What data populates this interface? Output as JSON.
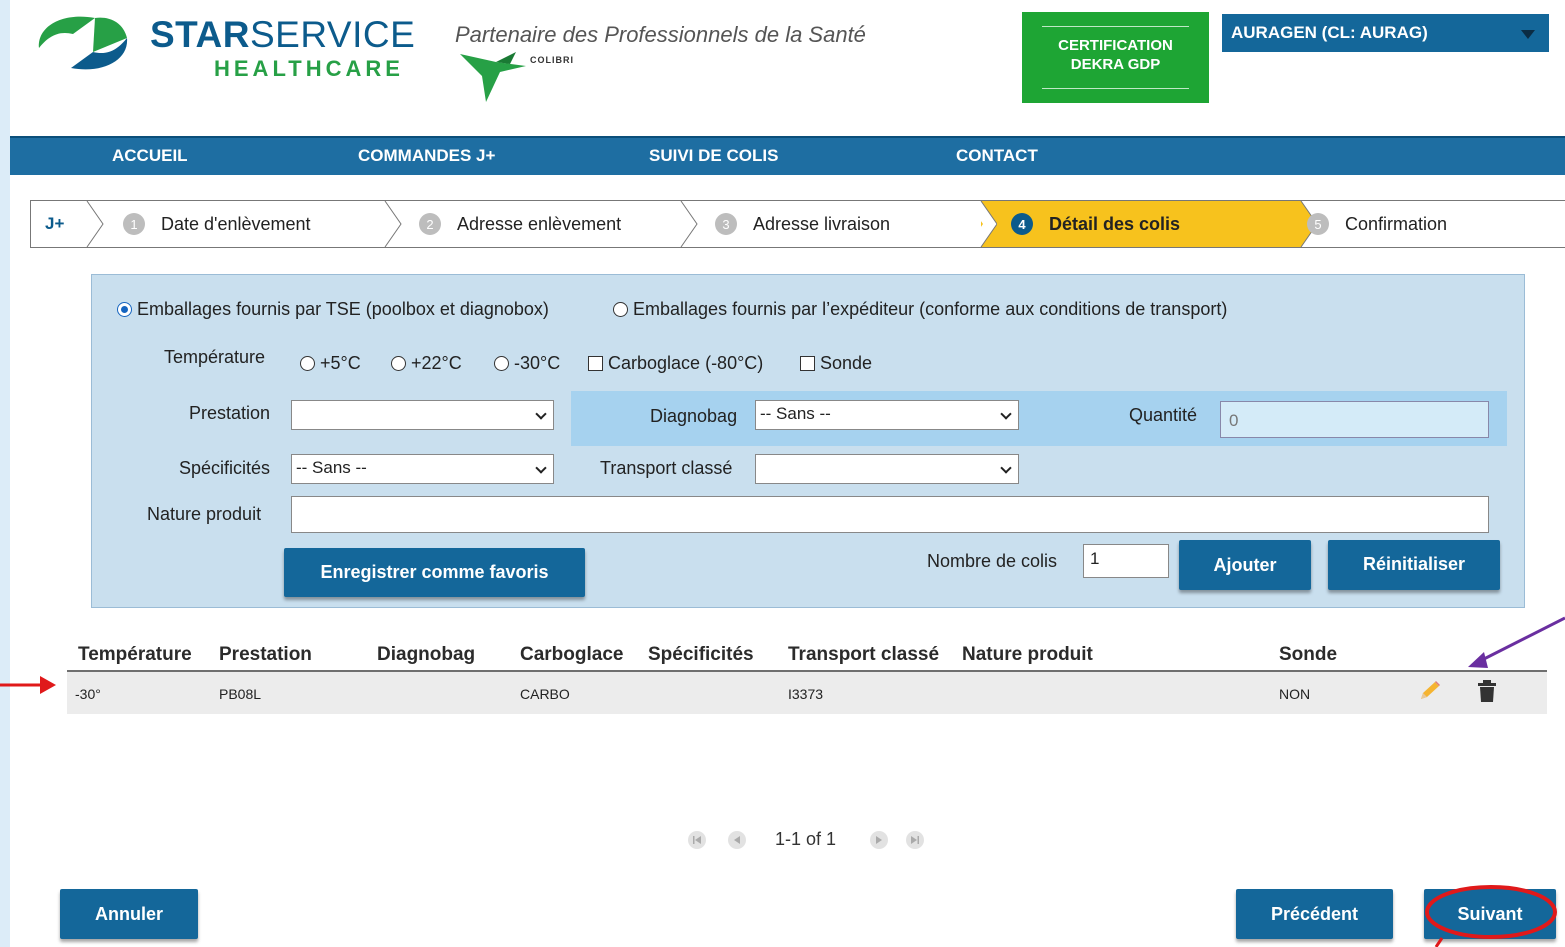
{
  "header": {
    "brand_bold": "STAR",
    "brand_light": "SERVICE",
    "brand_sub": "HEALTHCARE",
    "tagline": "Partenaire des Professionnels de la Santé",
    "colibri": "COLIBRI",
    "cert_line1": "CERTIFICATION",
    "cert_line2": "DEKRA GDP",
    "account": "AURAGEN (CL: AURAG)"
  },
  "nav": [
    "ACCUEIL",
    "COMMANDES J+",
    "SUIVI DE COLIS",
    "CONTACT"
  ],
  "stepper": {
    "prefix": "J+",
    "steps": [
      {
        "num": "1",
        "label": "Date d'enlèvement"
      },
      {
        "num": "2",
        "label": "Adresse enlèvement"
      },
      {
        "num": "3",
        "label": "Adresse livraison"
      },
      {
        "num": "4",
        "label": "Détail des colis"
      },
      {
        "num": "5",
        "label": "Confirmation"
      }
    ]
  },
  "form": {
    "packaging_tse": "Emballages fournis par TSE (poolbox et diagnobox)",
    "packaging_sender": "Emballages fournis par l’expéditeur (conforme aux conditions de transport)",
    "temp_label": "Température",
    "temp_options": [
      "+5°C",
      "+22°C",
      "-30°C"
    ],
    "carboglace": "Carboglace (-80°C)",
    "sonde": "Sonde",
    "prestation_label": "Prestation",
    "prestation_value": "",
    "diagnobag_label": "Diagnobag",
    "diagnobag_value": "-- Sans --",
    "quantite_label": "Quantité",
    "quantite_value": "0",
    "specificites_label": "Spécificités",
    "specificites_value": "-- Sans --",
    "transport_label": "Transport classé",
    "transport_value": "",
    "nature_label": "Nature produit",
    "nature_value": "",
    "favoris_button": "Enregistrer comme favoris",
    "nb_colis_label": "Nombre de colis",
    "nb_colis_value": "1",
    "ajouter_button": "Ajouter",
    "reinit_button": "Réinitialiser"
  },
  "table": {
    "headers": [
      "Température",
      "Prestation",
      "Diagnobag",
      "Carboglace",
      "Spécificités",
      "Transport classé",
      "Nature produit",
      "Sonde"
    ],
    "rows": [
      {
        "temperature": "-30°",
        "prestation": "PB08L",
        "diagnobag": "",
        "carboglace": "CARBO",
        "specificites": "",
        "transport": "I3373",
        "nature": "",
        "sonde": "NON"
      }
    ]
  },
  "pager": {
    "text": "1-1 of 1"
  },
  "footer": {
    "annuler": "Annuler",
    "precedent": "Précédent",
    "suivant": "Suivant"
  },
  "colors": {
    "primary": "#14679a",
    "nav": "#1e6ea2",
    "active_step": "#f7c21d",
    "cert": "#1ea534",
    "annotation_red": "#e0191a",
    "annotation_purple": "#6a2fa0"
  }
}
